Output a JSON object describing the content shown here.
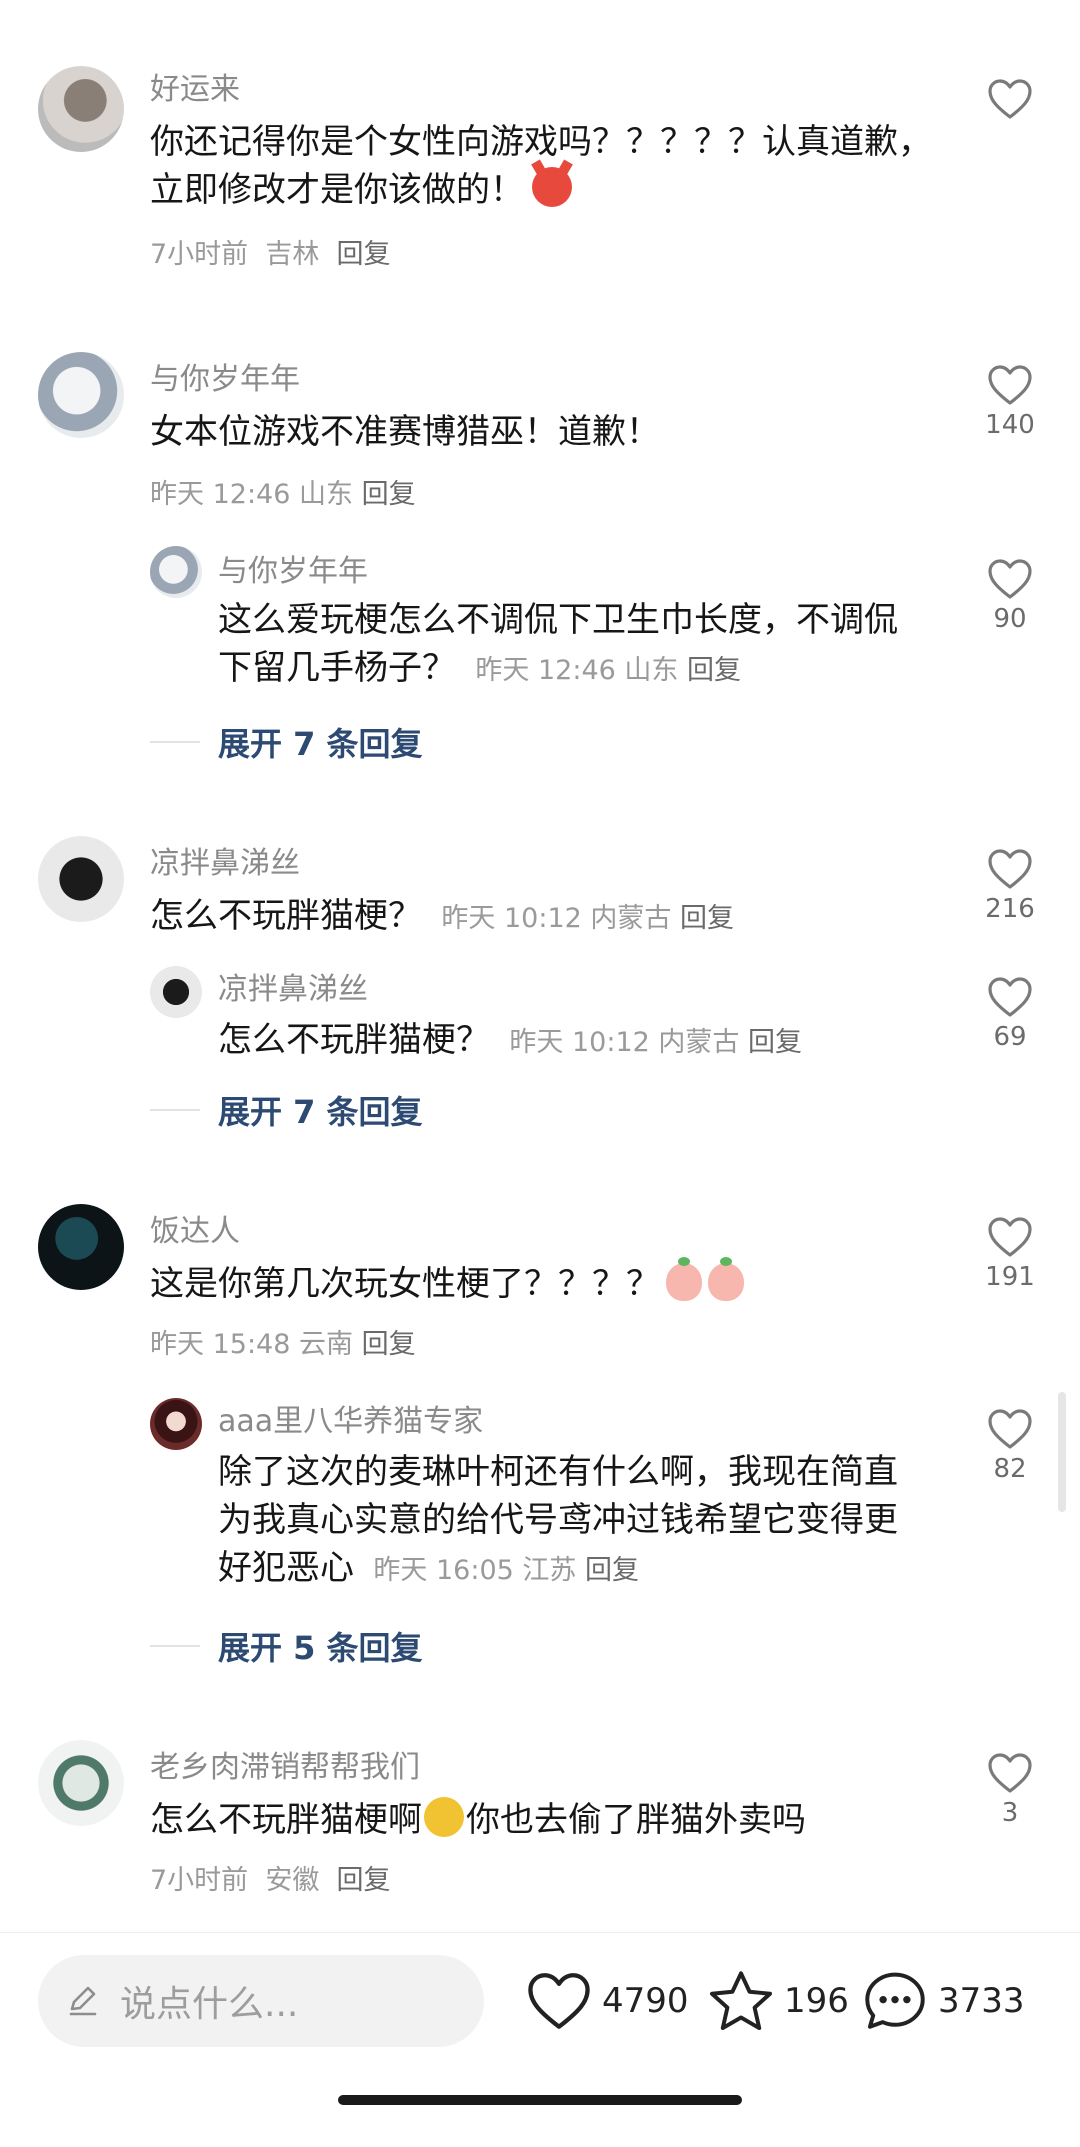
{
  "comments": [
    {
      "user": "好运来",
      "text": "你还记得你是个女性向游戏吗？？？？？认真道歉，立即修改才是你该做的！",
      "time": "7小时前",
      "location": "吉林",
      "reply_label": "回复",
      "likes": ""
    },
    {
      "user": "与你岁年年",
      "text": "女本位游戏不准赛博猎巫！道歉！",
      "time": "昨天 12:46",
      "location": "山东",
      "reply_label": "回复",
      "likes": "140",
      "sub": {
        "user": "与你岁年年",
        "text": "这么爱玩梗怎么不调侃下卫生巾长度，不调侃下留几手杨子？",
        "time": "昨天 12:46",
        "location": "山东",
        "reply_label": "回复",
        "likes": "90"
      },
      "expand": "展开 7 条回复"
    },
    {
      "user": "凉拌鼻涕丝",
      "text": "怎么不玩胖猫梗？",
      "time": "昨天 10:12",
      "location": "内蒙古",
      "reply_label": "回复",
      "likes": "216",
      "sub": {
        "user": "凉拌鼻涕丝",
        "text": "怎么不玩胖猫梗？",
        "time": "昨天 10:12",
        "location": "内蒙古",
        "reply_label": "回复",
        "likes": "69"
      },
      "expand": "展开 7 条回复"
    },
    {
      "user": "饭达人",
      "text": "这是你第几次玩女性梗了？？？？",
      "time": "昨天 15:48",
      "location": "云南",
      "reply_label": "回复",
      "likes": "191",
      "sub": {
        "user": "aaa里八华养猫专家",
        "text": "除了这次的麦琳叶柯还有什么啊，我现在简直为我真心实意的给代号鸢冲过钱希望它变得更好犯恶心",
        "time": "昨天 16:05",
        "location": "江苏",
        "reply_label": "回复",
        "likes": "82"
      },
      "expand": "展开 5 条回复"
    },
    {
      "user": "老乡肉滞销帮帮我们",
      "text_before": "怎么不玩胖猫梗啊",
      "text_after": "你也去偷了胖猫外卖吗",
      "time": "7小时前",
      "location": "安徽",
      "reply_label": "回复",
      "likes": "3"
    }
  ],
  "bottom_bar": {
    "input_placeholder": "说点什么...",
    "likes": "4790",
    "favorites": "196",
    "comments": "3733"
  }
}
